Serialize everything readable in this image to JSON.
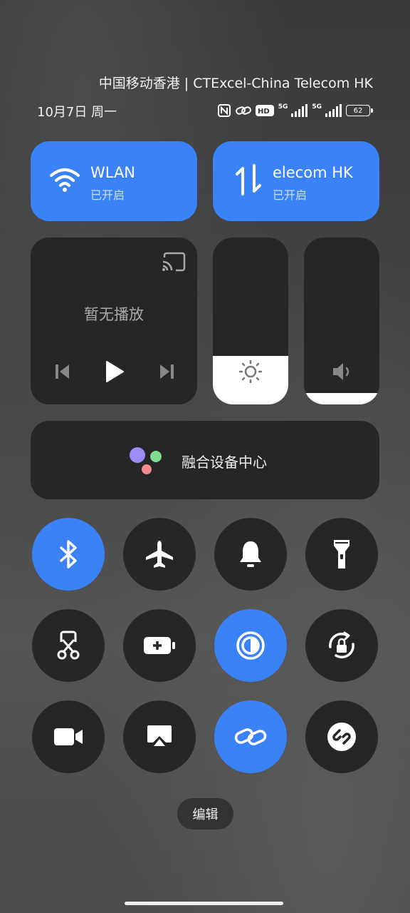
{
  "status_bar": {
    "carrier": "中国移动香港 | CTExcel-China Telecom HK",
    "date": "10月7日 周一",
    "hd_label": "HD",
    "sim1_label": "5G",
    "sim2_label": "5G",
    "battery": "62"
  },
  "tiles": {
    "wlan": {
      "title": "WLAN",
      "status": "已开启"
    },
    "data": {
      "title": "elecom HK",
      "status": "已开启"
    }
  },
  "media": {
    "no_playback": "暂无播放"
  },
  "sliders": {
    "brightness_level": 0.29,
    "volume_level": 0.07
  },
  "device_center": {
    "label": "融合设备中心"
  },
  "toggles": [
    {
      "icon": "bluetooth-icon",
      "on": true
    },
    {
      "icon": "airplane-icon",
      "on": false
    },
    {
      "icon": "bell-icon",
      "on": false
    },
    {
      "icon": "flashlight-icon",
      "on": false
    },
    {
      "icon": "screenshot-scissors-icon",
      "on": false
    },
    {
      "icon": "battery-saver-icon",
      "on": false
    },
    {
      "icon": "reading-mode-icon",
      "on": true
    },
    {
      "icon": "rotation-lock-icon",
      "on": false
    },
    {
      "icon": "video-camera-icon",
      "on": false
    },
    {
      "icon": "screen-cast-icon",
      "on": false
    },
    {
      "icon": "link-icon",
      "on": true
    },
    {
      "icon": "shazam-icon",
      "on": false
    }
  ],
  "edit_label": "编辑",
  "colors": {
    "accent": "#3b82f6",
    "tile_dark": "#262626"
  }
}
